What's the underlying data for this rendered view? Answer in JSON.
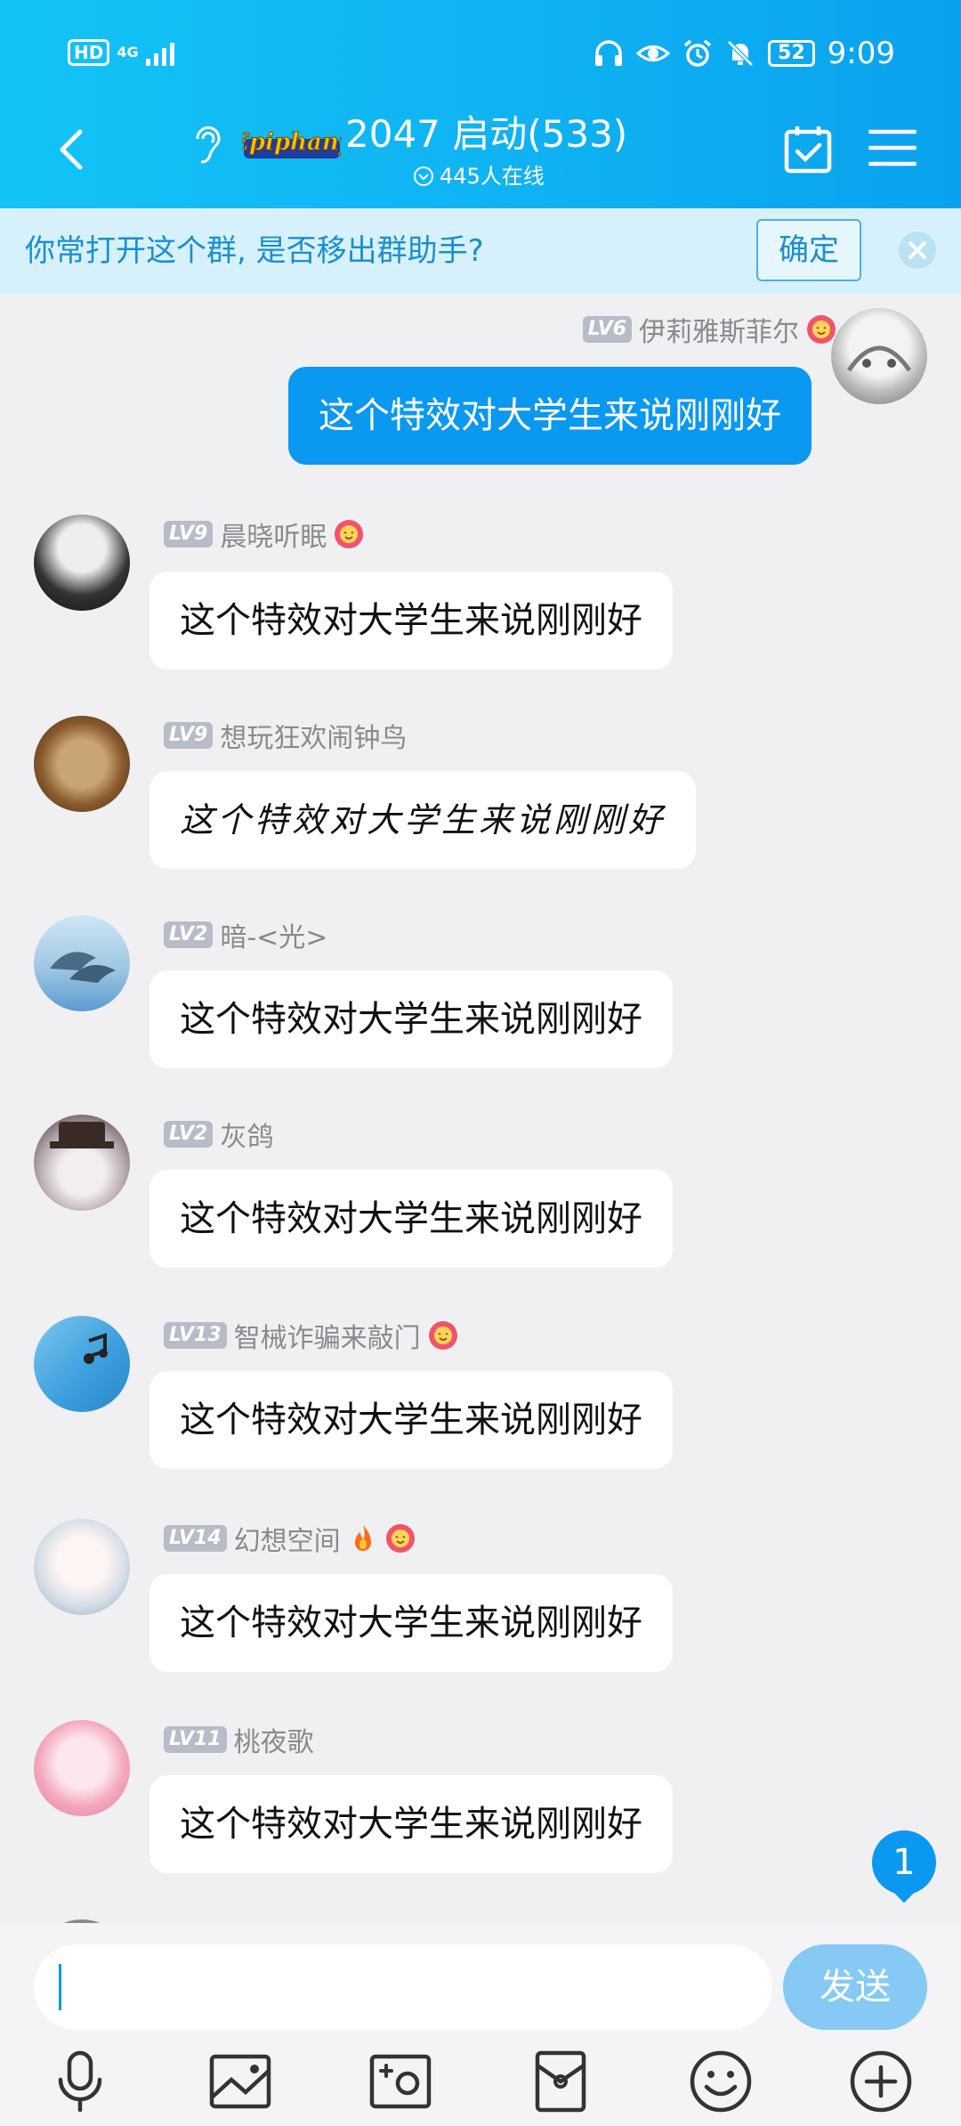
{
  "status_bar": {
    "hd": "HD",
    "network": "4G",
    "battery": "52",
    "time": "9:09"
  },
  "header": {
    "group_logo_text": "Epiphany",
    "title": "2047 启动(533)",
    "online": "445人在线"
  },
  "banner": {
    "text": "你常打开这个群, 是否移出群助手?",
    "confirm": "确定"
  },
  "messages": [
    {
      "level": "LV6",
      "name": "伊莉雅斯菲尔",
      "text": "这个特效对大学生来说刚刚好",
      "self": true
    },
    {
      "level": "LV9",
      "name": "晨晓听眠",
      "text": "这个特效对大学生来说刚刚好"
    },
    {
      "level": "LV9",
      "name": "想玩狂欢闹钟鸟",
      "text": "这个特效对大学生来说刚刚好"
    },
    {
      "level": "LV2",
      "name": "暗-<光>",
      "text": "这个特效对大学生来说刚刚好"
    },
    {
      "level": "LV2",
      "name": "灰鸽",
      "text": "这个特效对大学生来说刚刚好"
    },
    {
      "level": "LV13",
      "name": "智械诈骗来敲门",
      "text": "这个特效对大学生来说刚刚好"
    },
    {
      "level": "LV14",
      "name": "幻想空间",
      "text": "这个特效对大学生来说刚刚好"
    },
    {
      "level": "LV11",
      "name": "桃夜歌",
      "text": "这个特效对大学生来说刚刚好"
    }
  ],
  "unread_count": "1",
  "input": {
    "placeholder": "",
    "send": "发送"
  },
  "toolbar_icons": [
    "microphone-icon",
    "image-icon",
    "camera-icon",
    "red-packet-icon",
    "emoji-icon",
    "plus-icon"
  ],
  "colors": {
    "header": "#12c4f6",
    "accent": "#0a98f0",
    "banner_bg": "#d7f1fc",
    "send_disabled": "#86c9f5"
  }
}
